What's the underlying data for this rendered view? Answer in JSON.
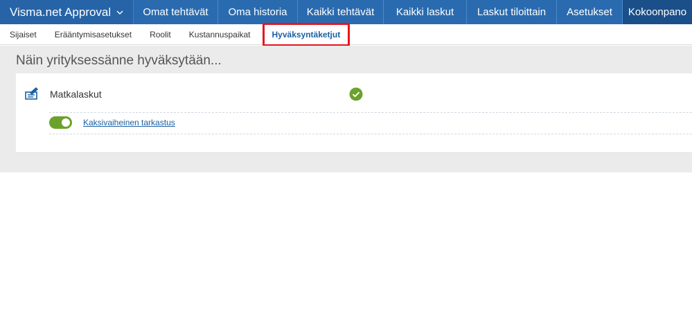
{
  "topbar": {
    "app_title": "Visma.net Approval",
    "items": [
      {
        "label": "Omat tehtävät"
      },
      {
        "label": "Oma historia"
      },
      {
        "label": "Kaikki tehtävät"
      },
      {
        "label": "Kaikki laskut"
      },
      {
        "label": "Laskut tiloittain"
      },
      {
        "label": "Asetukset"
      },
      {
        "label": "Kokoonpano"
      }
    ],
    "active": "Kokoonpano"
  },
  "subnav": {
    "items": [
      {
        "label": "Sijaiset"
      },
      {
        "label": "Erääntymisasetukset"
      },
      {
        "label": "Roolit"
      },
      {
        "label": "Kustannuspaikat"
      },
      {
        "label": "Hyväksyntäketjut"
      }
    ],
    "selected": "Hyväksyntäketjut"
  },
  "main": {
    "heading": "Näin yrityksessänne hyväksytään...",
    "card": {
      "icon": "expense-report-icon",
      "title": "Matkalaskut",
      "status_icon": "check-circle-icon",
      "toggle": {
        "on": true,
        "label": "Kaksivaiheinen tarkastus"
      }
    }
  },
  "colors": {
    "nav_bg": "#2a6bb0",
    "nav_active": "#1a4f8a",
    "link": "#1a5fa3",
    "toggle_on": "#6aa22b",
    "highlight_box": "#e8141c"
  }
}
